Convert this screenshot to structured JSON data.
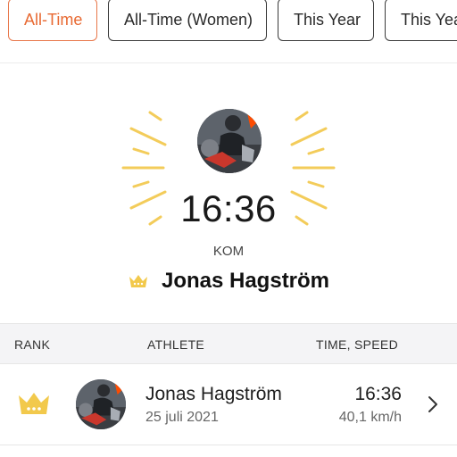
{
  "filters": [
    {
      "label": "All-Time",
      "active": true
    },
    {
      "label": "All-Time (Women)",
      "active": false
    },
    {
      "label": "This Year",
      "active": false
    },
    {
      "label": "This Yea",
      "active": false
    }
  ],
  "hero": {
    "time": "16:36",
    "title_label": "KOM",
    "athlete_name": "Jonas Hagström",
    "crown_icon": "crown-icon",
    "avatar_icon": "athlete-avatar"
  },
  "table": {
    "headers": {
      "rank": "RANK",
      "athlete": "ATHLETE",
      "time_speed": "TIME, SPEED"
    },
    "rows": [
      {
        "rank_icon": "crown-icon",
        "athlete": "Jonas Hagström",
        "date": "25 juli 2021",
        "time": "16:36",
        "speed": "40,1 km/h"
      }
    ]
  },
  "colors": {
    "accent": "#e86a33",
    "crown": "#f2c94c",
    "rays": "#f3cc5a",
    "header_bg": "#f4f4f6"
  }
}
